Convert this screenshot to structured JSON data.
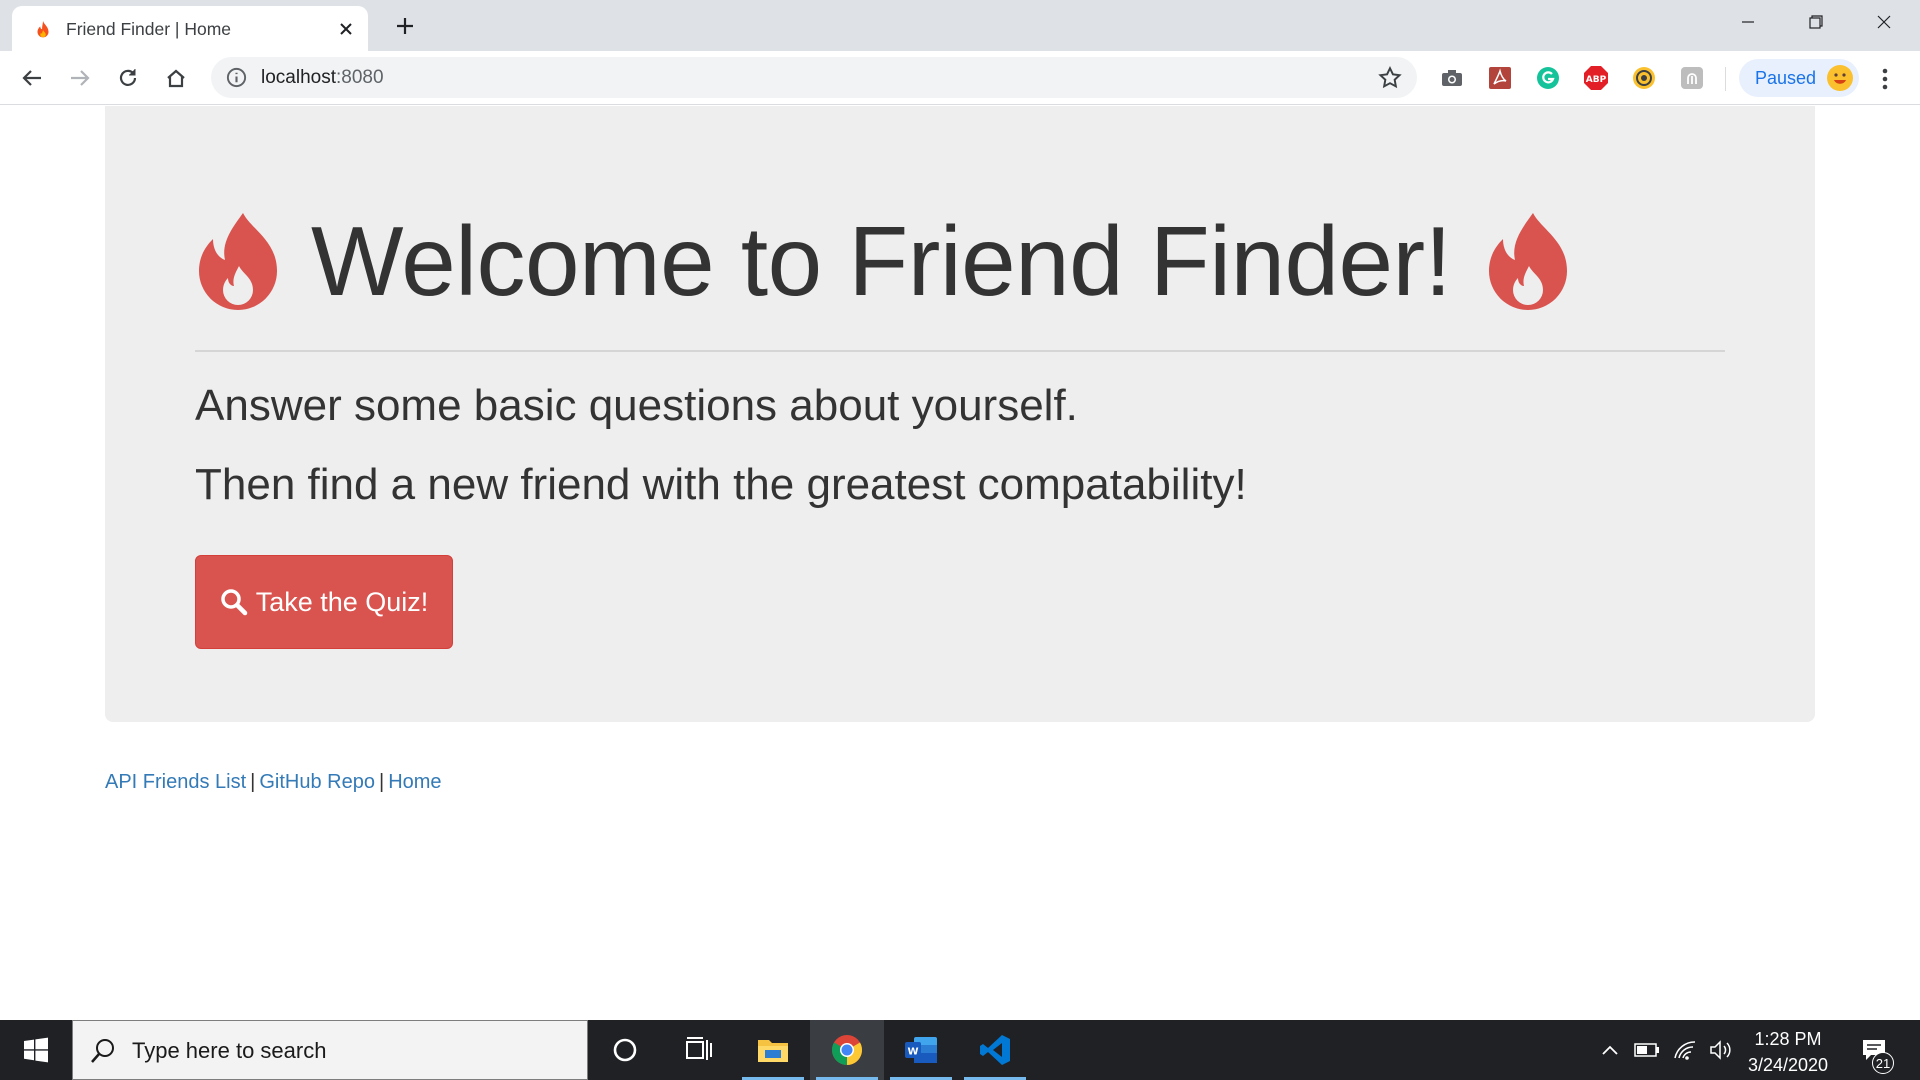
{
  "browser": {
    "tab": {
      "title": "Friend Finder | Home"
    },
    "address": {
      "host": "localhost",
      "port": ":8080"
    },
    "profile": {
      "label": "Paused"
    }
  },
  "page": {
    "title": "Welcome to Friend Finder!",
    "lead_lines": [
      "Answer some basic questions about yourself.",
      "Then find a new friend with the greatest compatability!"
    ],
    "cta_label": "Take the Quiz!",
    "footer": {
      "links": [
        "API Friends List",
        "GitHub Repo",
        "Home"
      ],
      "separator": "|"
    }
  },
  "taskbar": {
    "search_placeholder": "Type here to search",
    "time": "1:28 PM",
    "date": "3/24/2020",
    "notifications": "21"
  },
  "colors": {
    "brand_red": "#d9534f",
    "link_blue": "#337ab7",
    "jumbotron_bg": "#eeeeee"
  },
  "icons": {
    "hero": "fire-icon",
    "cta": "search-icon"
  }
}
